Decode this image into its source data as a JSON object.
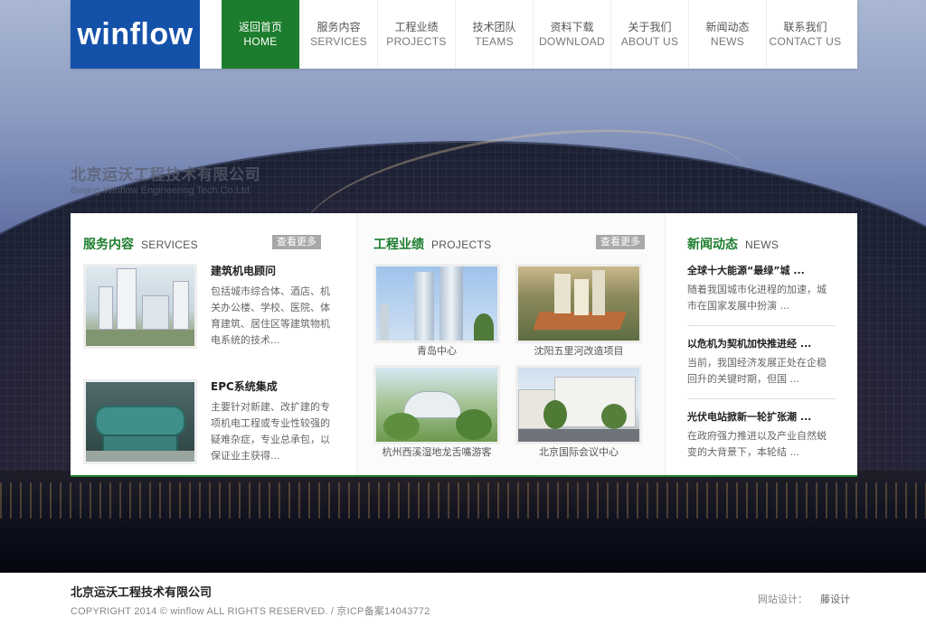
{
  "header": {
    "logo": "winflow",
    "nav": [
      {
        "zh": "返回首页",
        "en": "HOME",
        "active": true
      },
      {
        "zh": "服务内容",
        "en": "SERVICES"
      },
      {
        "zh": "工程业绩",
        "en": "PROJECTS"
      },
      {
        "zh": "技术团队",
        "en": "TEAMS"
      },
      {
        "zh": "资料下载",
        "en": "DOWNLOAD"
      },
      {
        "zh": "关于我们",
        "en": "ABOUT US"
      },
      {
        "zh": "新闻动态",
        "en": "NEWS"
      },
      {
        "zh": "联系我们",
        "en": "CONTACT US"
      }
    ]
  },
  "hero": {
    "company_zh": "北京运沃工程技术有限公司",
    "company_en": "Beijing Winflow Engineering Tech Co.Ltd"
  },
  "services": {
    "title_zh": "服务内容",
    "title_en": "SERVICES",
    "more": "查看更多",
    "items": [
      {
        "title": "建筑机电顾问",
        "desc": "包括城市综合体、酒店、机关办公楼、学校、医院、体育建筑、居住区等建筑物机电系统的技术..."
      },
      {
        "title": "EPC系统集成",
        "desc": "主要针对新建、改扩建的专项机电工程或专业性较强的疑难杂症，专业总承包，以保证业主获得..."
      }
    ]
  },
  "projects": {
    "title_zh": "工程业绩",
    "title_en": "PROJECTS",
    "more": "查看更多",
    "items": [
      {
        "caption": "青岛中心"
      },
      {
        "caption": "沈阳五里河改造项目"
      },
      {
        "caption": "杭州西溪湿地龙舌嘴游客"
      },
      {
        "caption": "北京国际会议中心"
      }
    ]
  },
  "news": {
    "title_zh": "新闻动态",
    "title_en": "NEWS",
    "items": [
      {
        "title": "全球十大能源“最绿”城 ...",
        "desc": "随着我国城市化进程的加速，城市在国家发展中扮演 ..."
      },
      {
        "title": "以危机为契机加快推进经 ...",
        "desc": "当前，我国经济发展正处在企稳回升的关键时期，但国 ..."
      },
      {
        "title": "光伏电站掀新一轮扩张潮 ...",
        "desc": "在政府强力推进以及产业自然蜕变的大背景下，本轮结 ..."
      }
    ]
  },
  "footer": {
    "name": "北京运沃工程技术有限公司",
    "copyright": "COPYRIGHT 2014 © winflow ALL RIGHTS RESERVED. / 京ICP备案14043772",
    "design_label": "网站设计：",
    "design_by": "藤设计"
  },
  "colors": {
    "brand_blue": "#1451a9",
    "brand_green": "#1d7d2e",
    "more_button": "#a8a8a8"
  }
}
